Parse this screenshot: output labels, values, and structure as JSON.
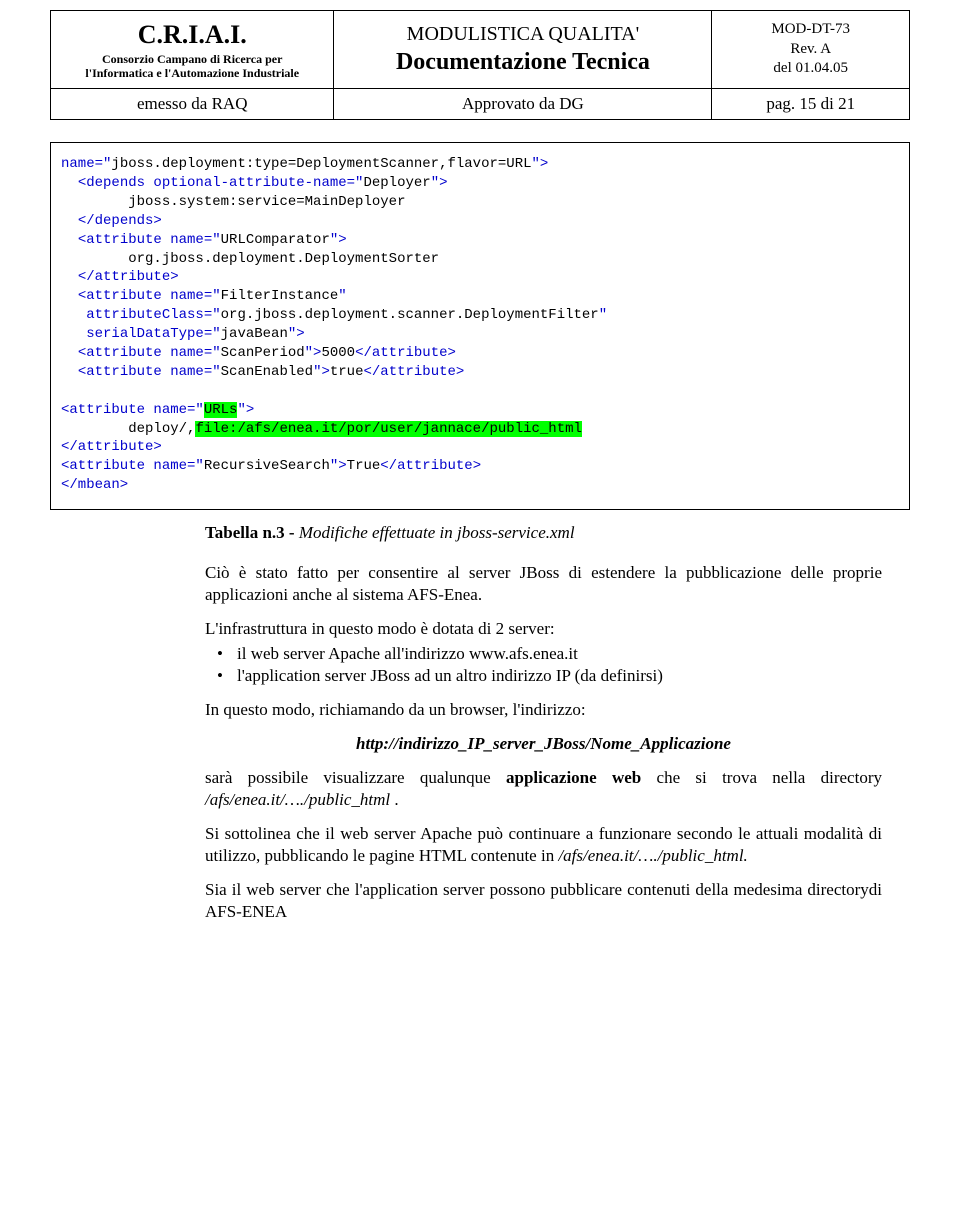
{
  "header": {
    "org": {
      "acronym": "C.R.I.A.I.",
      "sub1": "Consorzio Campano di Ricerca per",
      "sub2": "l'Informatica e l'Automazione Industriale"
    },
    "doc": {
      "line1": "MODULISTICA QUALITA'",
      "line2": "Documentazione Tecnica"
    },
    "meta": {
      "code": "MOD-DT-73",
      "rev": "Rev. A",
      "date": "del 01.04.05"
    },
    "issued": "emesso da RAQ",
    "approved": "Approvato da DG",
    "page": "pag. 15 di 21"
  },
  "code": {
    "parts": [
      {
        "cls": "blue",
        "txt": "name=\""
      },
      {
        "cls": "",
        "txt": "jboss.deployment:type=DeploymentScanner,flavor=URL"
      },
      {
        "cls": "blue",
        "txt": "\">"
      },
      {
        "cls": "",
        "txt": "\n  "
      },
      {
        "cls": "blue",
        "txt": "<depends optional-attribute-name=\""
      },
      {
        "cls": "",
        "txt": "Deployer"
      },
      {
        "cls": "blue",
        "txt": "\">"
      },
      {
        "cls": "",
        "txt": "\n        jboss.system:service=MainDeployer\n  "
      },
      {
        "cls": "blue",
        "txt": "</depends>"
      },
      {
        "cls": "",
        "txt": "\n  "
      },
      {
        "cls": "blue",
        "txt": "<attribute name=\""
      },
      {
        "cls": "",
        "txt": "URLComparator"
      },
      {
        "cls": "blue",
        "txt": "\">"
      },
      {
        "cls": "",
        "txt": "\n        org.jboss.deployment.DeploymentSorter\n  "
      },
      {
        "cls": "blue",
        "txt": "</attribute>"
      },
      {
        "cls": "",
        "txt": "\n  "
      },
      {
        "cls": "blue",
        "txt": "<attribute name=\""
      },
      {
        "cls": "",
        "txt": "FilterInstance"
      },
      {
        "cls": "blue",
        "txt": "\""
      },
      {
        "cls": "",
        "txt": "\n   "
      },
      {
        "cls": "blue",
        "txt": "attributeClass=\""
      },
      {
        "cls": "",
        "txt": "org.jboss.deployment.scanner.DeploymentFilter"
      },
      {
        "cls": "blue",
        "txt": "\""
      },
      {
        "cls": "",
        "txt": "\n   "
      },
      {
        "cls": "blue",
        "txt": "serialDataType=\""
      },
      {
        "cls": "",
        "txt": "javaBean"
      },
      {
        "cls": "blue",
        "txt": "\">"
      },
      {
        "cls": "",
        "txt": "\n  "
      },
      {
        "cls": "blue",
        "txt": "<attribute name=\""
      },
      {
        "cls": "",
        "txt": "ScanPeriod"
      },
      {
        "cls": "blue",
        "txt": "\">"
      },
      {
        "cls": "",
        "txt": "5000"
      },
      {
        "cls": "blue",
        "txt": "</attribute>"
      },
      {
        "cls": "",
        "txt": "\n  "
      },
      {
        "cls": "blue",
        "txt": "<attribute name=\""
      },
      {
        "cls": "",
        "txt": "ScanEnabled"
      },
      {
        "cls": "blue",
        "txt": "\">"
      },
      {
        "cls": "",
        "txt": "true"
      },
      {
        "cls": "blue",
        "txt": "</attribute>"
      },
      {
        "cls": "",
        "txt": "\n\n"
      },
      {
        "cls": "blue",
        "txt": "<attribute name=\""
      },
      {
        "cls": "hl",
        "txt": "URLs"
      },
      {
        "cls": "blue",
        "txt": "\">"
      },
      {
        "cls": "",
        "txt": "\n        deploy/,"
      },
      {
        "cls": "hl",
        "txt": "file:/afs/enea.it/por/user/jannace/public_html"
      },
      {
        "cls": "",
        "txt": "\n"
      },
      {
        "cls": "blue",
        "txt": "</attribute>"
      },
      {
        "cls": "",
        "txt": "\n"
      },
      {
        "cls": "blue",
        "txt": "<attribute name=\""
      },
      {
        "cls": "",
        "txt": "RecursiveSearch"
      },
      {
        "cls": "blue",
        "txt": "\">"
      },
      {
        "cls": "",
        "txt": "True"
      },
      {
        "cls": "blue",
        "txt": "</attribute>"
      },
      {
        "cls": "",
        "txt": "\n"
      },
      {
        "cls": "blue",
        "txt": "</mbean>"
      }
    ]
  },
  "caption": {
    "bold": "Tabella n.3 -",
    "italic": "Modifiche effettuate in jboss-service.xml"
  },
  "body": {
    "p1": "Ciò è stato fatto per consentire al server JBoss di estendere la pubblicazione delle proprie applicazioni anche al sistema  AFS-Enea.",
    "p2": "L'infrastruttura in questo modo è dotata di 2 server:",
    "bullets": [
      "il web server Apache all'indirizzo www.afs.enea.it",
      "l'application server JBoss ad un altro indirizzo IP (da definirsi)"
    ],
    "p3": "In questo modo, richiamando da un browser, l'indirizzo:",
    "url_line": "http://indirizzo_IP_server_JBoss/Nome_Applicazione",
    "p4_a": "sarà possibile visualizzare qualunque ",
    "p4_b": "applicazione web",
    "p4_c": " che si trova nella directory ",
    "p4_d": "/afs/enea.it/…./public_html ",
    "p4_e": ".",
    "p5_a": "Si sottolinea che il web server Apache può continuare a funzionare secondo le attuali modalità di utilizzo, pubblicando le pagine HTML contenute in ",
    "p5_b": "/afs/enea.it/…./public_html.",
    "p6": "Sia il web server che l'application server possono pubblicare contenuti della medesima directorydi AFS-ENEA"
  }
}
